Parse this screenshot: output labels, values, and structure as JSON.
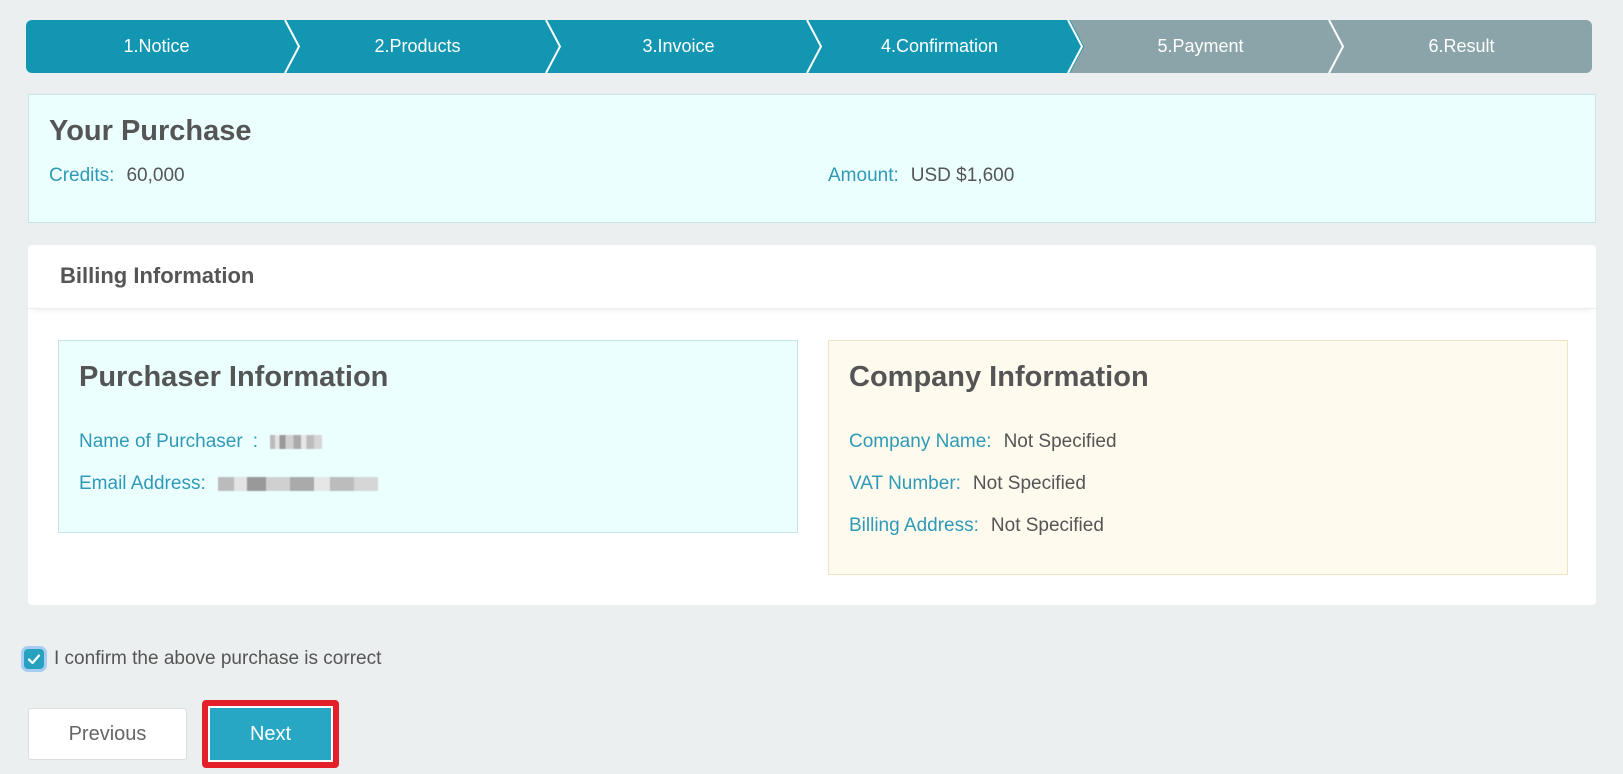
{
  "stepper": {
    "steps": [
      {
        "label": "1.Notice",
        "state": "active"
      },
      {
        "label": "2.Products",
        "state": "active"
      },
      {
        "label": "3.Invoice",
        "state": "active"
      },
      {
        "label": "4.Confirmation",
        "state": "active"
      },
      {
        "label": "5.Payment",
        "state": "inactive"
      },
      {
        "label": "6.Result",
        "state": "inactive"
      }
    ],
    "colors": {
      "active": "#1296b2",
      "inactive": "#8aa4a9"
    }
  },
  "purchase": {
    "title": "Your Purchase",
    "credits_label": "Credits:",
    "credits_value": "60,000",
    "amount_label": "Amount:",
    "amount_value": "USD $1,600"
  },
  "billing": {
    "title": "Billing Information",
    "purchaser": {
      "title": "Purchaser Information",
      "name_label": "Name of Purchaser",
      "name_separator": ":",
      "email_label": "Email Address:"
    },
    "company": {
      "title": "Company Information",
      "company_name_label": "Company Name:",
      "company_name_value": "Not Specified",
      "vat_label": "VAT Number:",
      "vat_value": "Not Specified",
      "address_label": "Billing Address:",
      "address_value": "Not Specified"
    }
  },
  "confirm": {
    "label": "I confirm the above purchase is correct",
    "checked": true
  },
  "buttons": {
    "previous": "Previous",
    "next": "Next"
  },
  "colors": {
    "accent": "#2f9ab8",
    "highlight": "#e3202a",
    "primary_button": "#27a7c4"
  }
}
